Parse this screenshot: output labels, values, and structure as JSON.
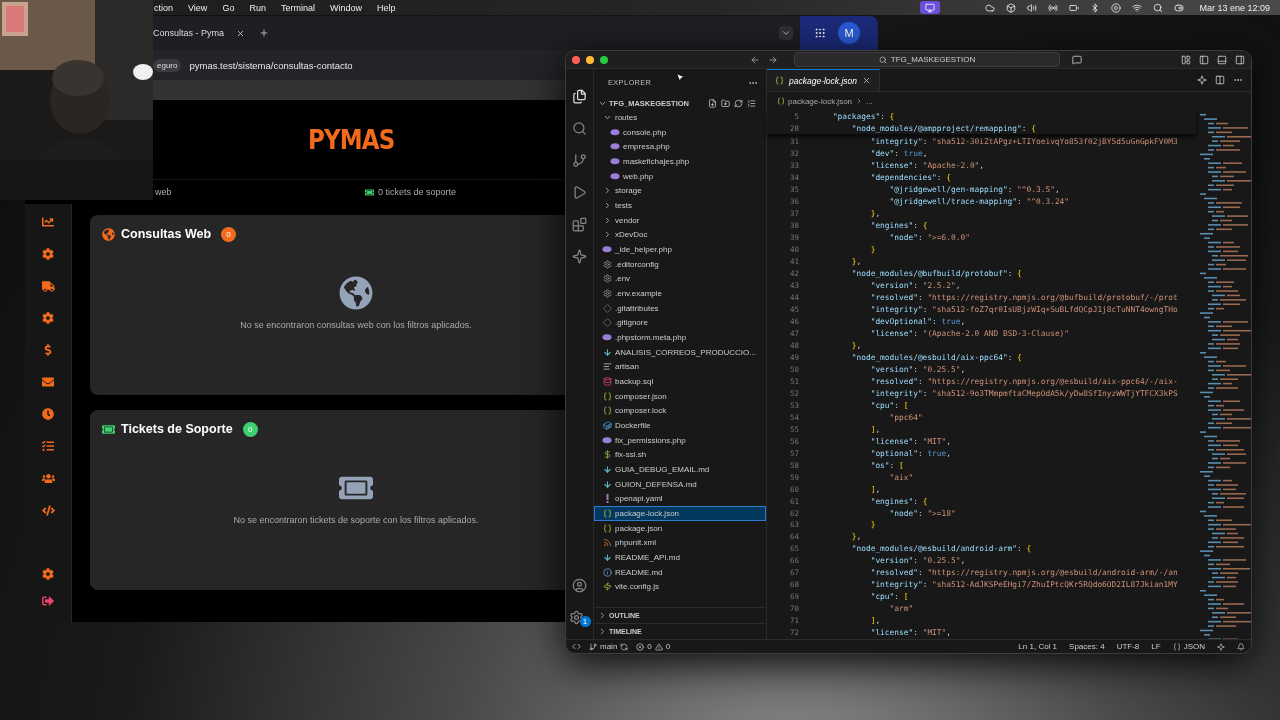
{
  "menu_bar": {
    "app_menus": [
      "ction",
      "View",
      "Go",
      "Run",
      "Terminal",
      "Window",
      "Help"
    ],
    "clock": "Mar 13 ene 12:09"
  },
  "browser": {
    "tab_title": "Consultas - Pyma",
    "address_prefix": "eguro",
    "url": "pymas.test/sistema/consultas-contacto",
    "profile_initial": "M",
    "logo": "PYMAS",
    "filter_label": "web",
    "tickets_summary": "0 tickets de soporte",
    "cards": [
      {
        "kind": "globe",
        "title": "Consultas Web",
        "count": "0",
        "color": "#f26b1d",
        "empty_message": "No se encontraron consultas web con los filtros aplicados."
      },
      {
        "kind": "ticket",
        "title": "Tickets de Soporte",
        "count": "0",
        "color": "#3ecf6e",
        "empty_message": "No se encontraron tickets de soporte con los filtros aplicados."
      }
    ]
  },
  "vscode": {
    "search": "TFG_MASKEGESTION",
    "settings_badge": "1",
    "explorer": {
      "title": "EXPLORER",
      "root": "TFG_MASKEGESTION",
      "items": [
        {
          "name": "routes",
          "kind": "folder",
          "expanded": true,
          "selected": false,
          "children": [
            {
              "name": "console.php",
              "kind": "php",
              "selected": false
            },
            {
              "name": "empresa.php",
              "kind": "php",
              "selected": false
            },
            {
              "name": "maskefichajes.php",
              "kind": "php",
              "selected": false
            },
            {
              "name": "web.php",
              "kind": "php",
              "selected": false
            }
          ]
        },
        {
          "name": "storage",
          "kind": "folder",
          "expanded": false,
          "selected": false
        },
        {
          "name": "tests",
          "kind": "folder",
          "expanded": false,
          "selected": false
        },
        {
          "name": "vendor",
          "kind": "folder",
          "expanded": false,
          "selected": false
        },
        {
          "name": "xDevDoc",
          "kind": "folder",
          "expanded": false,
          "selected": false
        },
        {
          "name": "_ide_helper.php",
          "kind": "php",
          "selected": false
        },
        {
          "name": ".editorconfig",
          "kind": "config",
          "selected": false
        },
        {
          "name": ".env",
          "kind": "config",
          "selected": false
        },
        {
          "name": ".env.example",
          "kind": "config",
          "selected": false
        },
        {
          "name": ".gitattributes",
          "kind": "git",
          "selected": false
        },
        {
          "name": ".gitignore",
          "kind": "git",
          "selected": false
        },
        {
          "name": ".phpstorm.meta.php",
          "kind": "php",
          "selected": false
        },
        {
          "name": "ANALISIS_CORREOS_PRODUCCIO...",
          "kind": "markdown",
          "selected": false
        },
        {
          "name": "artisan",
          "kind": "text",
          "selected": false
        },
        {
          "name": "backup.sql",
          "kind": "database",
          "selected": false
        },
        {
          "name": "composer.json",
          "kind": "json",
          "selected": false
        },
        {
          "name": "composer.lock",
          "kind": "json",
          "selected": false
        },
        {
          "name": "Dockerfile",
          "kind": "docker",
          "selected": false
        },
        {
          "name": "fix_permissions.php",
          "kind": "php",
          "selected": false
        },
        {
          "name": "fix-ssl.sh",
          "kind": "shell",
          "selected": false
        },
        {
          "name": "GUIA_DEBUG_EMAIL.md",
          "kind": "markdown",
          "selected": false
        },
        {
          "name": "GUION_DEFENSA.md",
          "kind": "markdown",
          "selected": false
        },
        {
          "name": "openapi.yaml",
          "kind": "yaml",
          "selected": false
        },
        {
          "name": "package-lock.json",
          "kind": "json",
          "selected": true
        },
        {
          "name": "package.json",
          "kind": "json",
          "selected": false
        },
        {
          "name": "phpunit.xml",
          "kind": "xml",
          "selected": false
        },
        {
          "name": "README_API.md",
          "kind": "markdown",
          "selected": false
        },
        {
          "name": "README.md",
          "kind": "info",
          "selected": false
        },
        {
          "name": "vite.config.js",
          "kind": "js",
          "selected": false
        }
      ],
      "sections": [
        {
          "label": "OUTLINE",
          "expanded": false
        },
        {
          "label": "TIMELINE",
          "expanded": false
        }
      ]
    },
    "tab": {
      "label": "package-lock.json"
    },
    "breadcrumb": [
      "package-lock.json",
      "..."
    ],
    "sticky_lines": [
      {
        "num": "5",
        "text": "    \"packages\": {"
      },
      {
        "num": "28",
        "text": "        \"node_modules/@ampproject/remapping\": {"
      }
    ],
    "lines": [
      {
        "num": "31",
        "text": "            \"integrity\": \"sha512-30iZtAPgz+LTIYoeivqYo853f02jBY5d5uGnGpkFV0M3"
      },
      {
        "num": "32",
        "text": "            \"dev\": true,"
      },
      {
        "num": "33",
        "text": "            \"license\": \"Apache-2.0\","
      },
      {
        "num": "34",
        "text": "            \"dependencies\": {"
      },
      {
        "num": "35",
        "text": "                \"@jridgewell/gen-mapping\": \"^0.3.5\","
      },
      {
        "num": "36",
        "text": "                \"@jridgewell/trace-mapping\": \"^0.3.24\""
      },
      {
        "num": "37",
        "text": "            },"
      },
      {
        "num": "38",
        "text": "            \"engines\": {"
      },
      {
        "num": "39",
        "text": "                \"node\": \">=6.0.0\""
      },
      {
        "num": "40",
        "text": "            }"
      },
      {
        "num": "41",
        "text": "        },"
      },
      {
        "num": "42",
        "text": "        \"node_modules/@bufbuild/protobuf\": {"
      },
      {
        "num": "43",
        "text": "            \"version\": \"2.5.2\","
      },
      {
        "num": "44",
        "text": "            \"resolved\": \"https://registry.npmjs.org/@bufbuild/protobuf/-/prot"
      },
      {
        "num": "45",
        "text": "            \"integrity\": \"sha512-foZ7qr0IsUBjzWIq+SuBLfdQCpJ1j8cTuNNT4owngTHo"
      },
      {
        "num": "46",
        "text": "            \"devOptional\": true,"
      },
      {
        "num": "47",
        "text": "            \"license\": \"(Apache-2.0 AND BSD-3-Clause)\""
      },
      {
        "num": "48",
        "text": "        },"
      },
      {
        "num": "49",
        "text": "        \"node_modules/@esbuild/aix-ppc64\": {"
      },
      {
        "num": "50",
        "text": "            \"version\": \"0.25.5\","
      },
      {
        "num": "51",
        "text": "            \"resolved\": \"https://registry.npmjs.org/@esbuild/aix-ppc64/-/aix-"
      },
      {
        "num": "52",
        "text": "            \"integrity\": \"sha512-9o3TMmpmftaCMepOdA5k/yDw8SfInyzWWTjYTFCX3kPS"
      },
      {
        "num": "53",
        "text": "            \"cpu\": ["
      },
      {
        "num": "54",
        "text": "                \"ppc64\""
      },
      {
        "num": "55",
        "text": "            ],"
      },
      {
        "num": "56",
        "text": "            \"license\": \"MIT\","
      },
      {
        "num": "57",
        "text": "            \"optional\": true,"
      },
      {
        "num": "58",
        "text": "            \"os\": ["
      },
      {
        "num": "59",
        "text": "                \"aix\""
      },
      {
        "num": "60",
        "text": "            ],"
      },
      {
        "num": "61",
        "text": "            \"engines\": {"
      },
      {
        "num": "62",
        "text": "                \"node\": \">=18\""
      },
      {
        "num": "63",
        "text": "            }"
      },
      {
        "num": "64",
        "text": "        },"
      },
      {
        "num": "65",
        "text": "        \"node_modules/@esbuild/android-arm\": {"
      },
      {
        "num": "66",
        "text": "            \"version\": \"0.25.5\","
      },
      {
        "num": "67",
        "text": "            \"resolved\": \"https://registry.npmjs.org/@esbuild/android-arm/-/an"
      },
      {
        "num": "68",
        "text": "            \"integrity\": \"sha512-AdJKSPeEHgi7/ZhuIPtcQKr5RQdo6OD2IL87Jkian1MY"
      },
      {
        "num": "69",
        "text": "            \"cpu\": ["
      },
      {
        "num": "70",
        "text": "                \"arm\""
      },
      {
        "num": "71",
        "text": "            ],"
      },
      {
        "num": "72",
        "text": "            \"license\": \"MIT\","
      }
    ],
    "status_bar": {
      "branch": "main",
      "errors": "0",
      "warnings": "0",
      "right": [
        "Ln 1, Col 1",
        "Spaces: 4",
        "UTF-8",
        "LF"
      ],
      "language": "JSON"
    }
  }
}
